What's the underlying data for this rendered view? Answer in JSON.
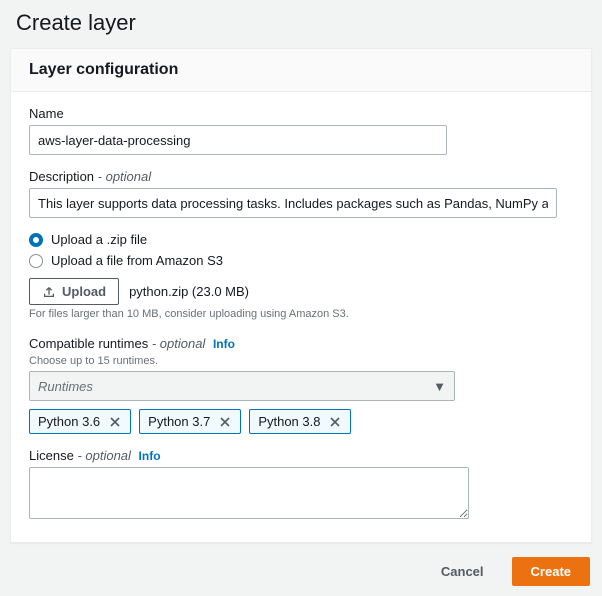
{
  "page": {
    "title": "Create layer"
  },
  "panel": {
    "title": "Layer configuration"
  },
  "name": {
    "label": "Name",
    "value": "aws-layer-data-processing"
  },
  "description": {
    "label": "Description",
    "optional": "- optional",
    "value": "This layer supports data processing tasks. Includes packages such as Pandas, NumPy a"
  },
  "source": {
    "opt_zip": "Upload a .zip file",
    "opt_s3": "Upload a file from Amazon S3",
    "upload_label": "Upload",
    "file_name": "python.zip (23.0 MB)",
    "hint": "For files larger than 10 MB, consider uploading using Amazon S3."
  },
  "runtimes": {
    "label": "Compatible runtimes",
    "optional": "- optional",
    "info": "Info",
    "sub": "Choose up to 15 runtimes.",
    "placeholder": "Runtimes",
    "tokens": [
      "Python 3.6",
      "Python 3.7",
      "Python 3.8"
    ]
  },
  "license": {
    "label": "License",
    "optional": "- optional",
    "info": "Info",
    "value": ""
  },
  "footer": {
    "cancel": "Cancel",
    "create": "Create"
  }
}
